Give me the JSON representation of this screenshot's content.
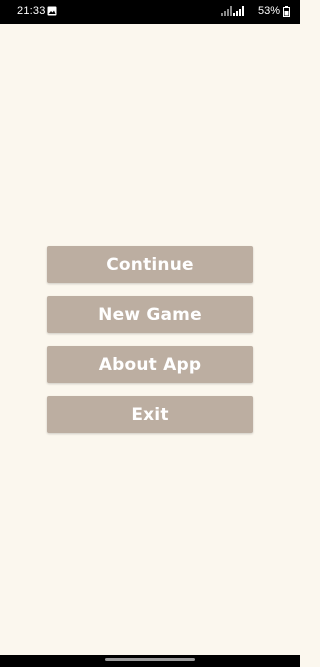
{
  "status_bar": {
    "time": "21:33",
    "battery": "53%",
    "icons": [
      "gallery-icon",
      "signal-icon",
      "signal-icon",
      "battery-icon"
    ]
  },
  "menu": {
    "continue_label": "Continue",
    "new_game_label": "New Game",
    "about_label": "About App",
    "exit_label": "Exit"
  },
  "colors": {
    "background": "#fbf7ee",
    "button": "#bcaea1",
    "button_text": "#ffffff"
  }
}
